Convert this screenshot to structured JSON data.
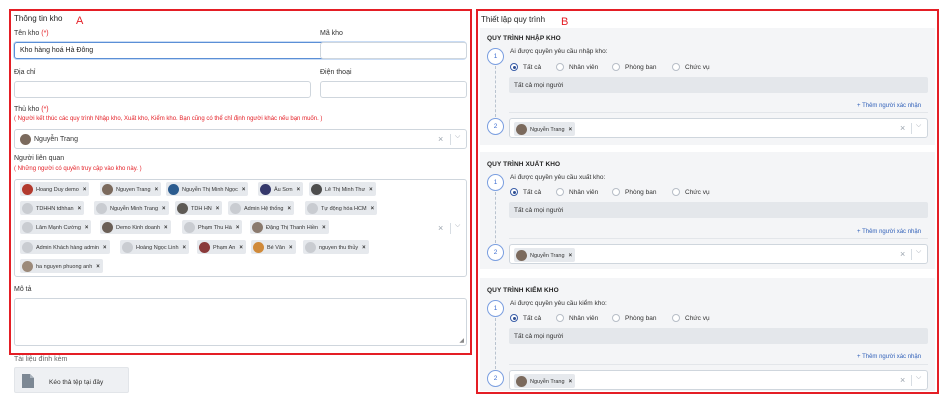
{
  "markers": {
    "a": "A",
    "b": "B"
  },
  "left": {
    "section_title": "Thông tin kho",
    "name_label": "Tên kho",
    "required_mark": "(*)",
    "name_value": "Kho hàng hoá Hà Đông",
    "code_label": "Mã kho",
    "code_value": "",
    "address_label": "Địa chỉ",
    "address_value": "",
    "phone_label": "Điện thoại",
    "phone_value": "",
    "keeper_label": "Thủ kho",
    "keeper_hint": "( Người kết thúc các quy trình Nhập kho, Xuất kho, Kiểm kho. Bạn cũng có thể chỉ định người khác nếu bạn muốn. )",
    "keeper_value": "Nguyễn Trang",
    "related_label": "Người liên quan",
    "related_hint": "( Những người có quyền truy cập vào kho này. )",
    "related_people": [
      "Hoang Duy demo",
      "Nguyen Trang",
      "Nguyễn Thị Minh Ngọc",
      "Âu Sơn",
      "Lê Thị Minh Thư",
      "TDHHN tdhhan",
      "Nguyễn Minh Trang",
      "TDH HN",
      "Admin Hệ thống",
      "Tự động hóa HCM",
      "Lâm Mạnh Cường",
      "Demo Kinh doanh",
      "Phạm Thu Hà",
      "Đặng Thị Thanh Hiền",
      "Admin Khách hàng admin",
      "Hoàng Ngọc Linh",
      "Phạm An",
      "Bé Vân",
      "nguyen thu thủy",
      "ha nguyen phuong anh"
    ],
    "desc_label": "Mô tả",
    "attach_label": "Tài liệu đính kèm",
    "upload_text": "Kéo thả tệp tại đây"
  },
  "right": {
    "section_title": "Thiết lập quy trình",
    "processes": [
      {
        "title": "QUY TRÌNH NHẬP KHO",
        "question": "Ai được quyền yêu cầu nhập kho:",
        "step1": "1",
        "step2": "2"
      },
      {
        "title": "QUY TRÌNH XUẤT KHO",
        "question": "Ai được quyền yêu cầu xuất kho:",
        "step1": "1",
        "step2": "2"
      },
      {
        "title": "QUY TRÌNH KIỂM KHO",
        "question": "Ai được quyền yêu cầu kiểm kho:",
        "step1": "1",
        "step2": "2"
      }
    ],
    "options": [
      "Tất cả",
      "Nhân viên",
      "Phòng ban",
      "Chức vụ"
    ],
    "selected_option": "Tất cả",
    "all_people_text": "Tất cả mọi người",
    "add_approver": "+ Thêm người xác nhận",
    "approver_value": "Nguyễn Trang"
  },
  "icons": {
    "remove": "×",
    "clear": "×",
    "chevron": "⌵",
    "resize": "◢"
  },
  "colors": {
    "highlight": "#e41e25",
    "link": "#2f5fb8",
    "radio": "#2f4f93"
  }
}
